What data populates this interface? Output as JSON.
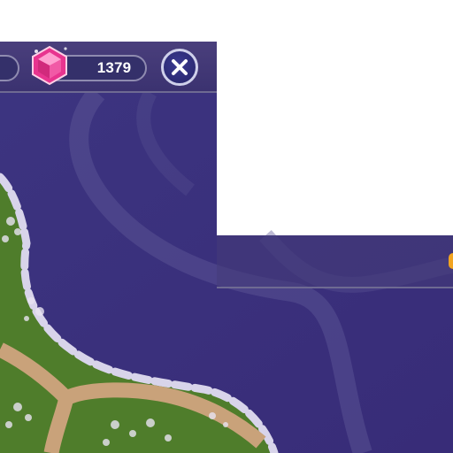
{
  "hud": {
    "gem_count": "1379"
  },
  "icons": {
    "gem": "pink-gem-icon",
    "close": "close-icon"
  },
  "colors": {
    "hud_background": "#3b3270",
    "gem_pink": "#e8348f",
    "map_path": "#c9a27a",
    "grass": "#4d7a2a",
    "water": "#3a2f7a",
    "accent_orange": "#f2a420"
  }
}
